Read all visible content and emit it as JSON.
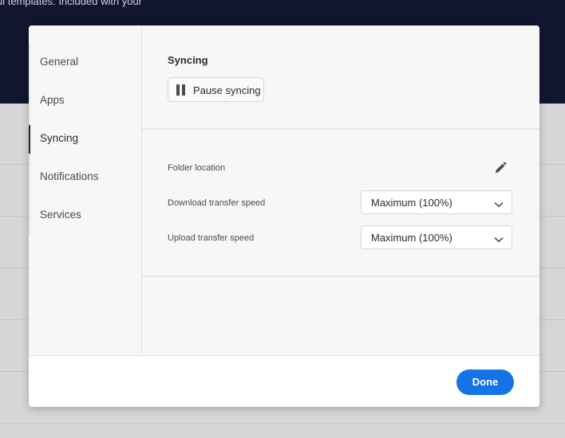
{
  "background": {
    "banner_text": "ul templates. Included with your"
  },
  "sidebar": {
    "items": [
      {
        "label": "General"
      },
      {
        "label": "Apps"
      },
      {
        "label": "Syncing",
        "selected": true
      },
      {
        "label": "Notifications"
      },
      {
        "label": "Services"
      }
    ]
  },
  "syncing": {
    "title": "Syncing",
    "pause_label": "Pause syncing",
    "pause_icon": "pause-icon"
  },
  "settings": {
    "folder_location_label": "Folder location",
    "edit_icon": "pencil-icon",
    "download_label": "Download transfer speed",
    "download_value": "Maximum (100%)",
    "upload_label": "Upload transfer speed",
    "upload_value": "Maximum (100%)"
  },
  "footer": {
    "done_label": "Done"
  },
  "colors": {
    "accent": "#1473e6",
    "banner": "#121530"
  }
}
